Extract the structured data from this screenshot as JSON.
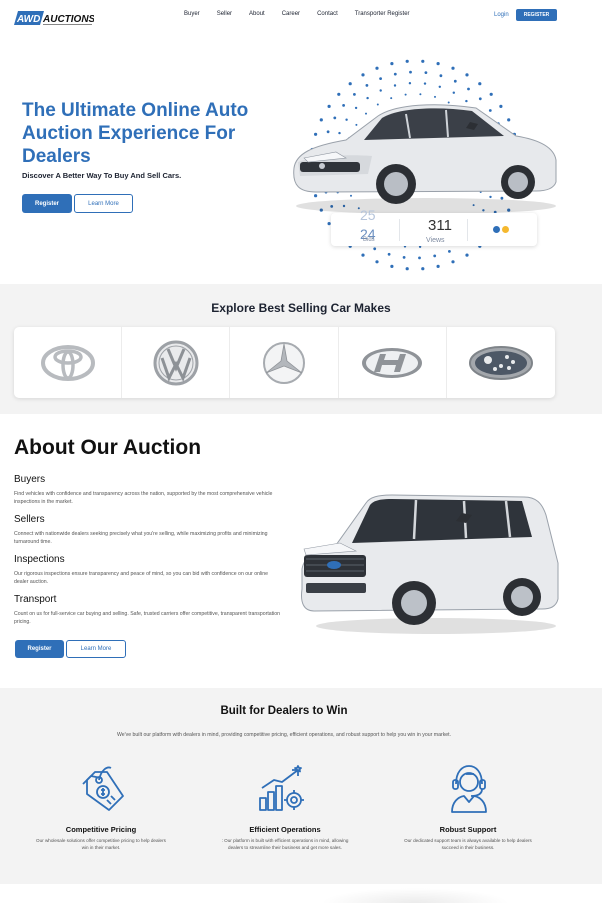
{
  "nav": {
    "logo_text": "AWD AUCTIONS",
    "links": [
      "Buyer",
      "Seller",
      "About",
      "Career",
      "Contact",
      "Transporter Register"
    ],
    "login": "Login",
    "register": "REGISTER"
  },
  "hero": {
    "title": "The Ultimate Online Auto Auction Experience For Dealers",
    "subtitle": "Discover A Better Way To Buy And Sell Cars.",
    "register_btn": "Register",
    "learn_btn": "Learn More",
    "stats": {
      "bids_value_a": "25",
      "bids_value_b": "24",
      "bids_label": "Bids",
      "views_value": "311",
      "views_label": "Views"
    },
    "colors": {
      "accent": "#2f6fb8",
      "dot_yellow": "#f5b82e"
    }
  },
  "makes": {
    "title": "Explore Best Selling Car Makes",
    "brands": [
      "toyota-logo",
      "volkswagen-logo",
      "mercedes-logo",
      "hyundai-logo",
      "subaru-logo"
    ]
  },
  "about": {
    "title": "About Our Auction",
    "items": [
      {
        "title": "Buyers",
        "text": "Find vehicles with confidence and transparency across the nation, supported by the most comprehensive vehicle inspections in the market."
      },
      {
        "title": "Sellers",
        "text": "Connect with nationwide dealers seeking precisely what you're selling, while maximizing profits and minimizing turnaround time."
      },
      {
        "title": "Inspections",
        "text": "Our rigorous inspections ensure transparency and peace of mind, so you can bid with confidence on our online dealer auction."
      },
      {
        "title": "Transport",
        "text": "Count on us for full-service car buying and selling. Safe, trusted carriers offer competitive, transparent transportation pricing."
      }
    ],
    "register_btn": "Register",
    "learn_btn": "Learn More"
  },
  "built": {
    "title": "Built for Dealers to Win",
    "subtitle": "We've built our platform with dealers in mind, providing competitive pricing, efficient operations, and robust support to help you win in your market.",
    "features": [
      {
        "icon": "price-tag-icon",
        "title": "Competitive Pricing",
        "text": "Our wholesale solutions offer competitive pricing to help dealers win in their market."
      },
      {
        "icon": "growth-chart-gear-icon",
        "title": "Efficient Operations",
        "text": ": Our platform is built with efficient operations in mind, allowing dealers to streamline their business and get more sales."
      },
      {
        "icon": "support-agent-icon",
        "title": "Robust Support",
        "text": "Our dedicated support team is always available to help dealers succeed in their business."
      }
    ]
  }
}
